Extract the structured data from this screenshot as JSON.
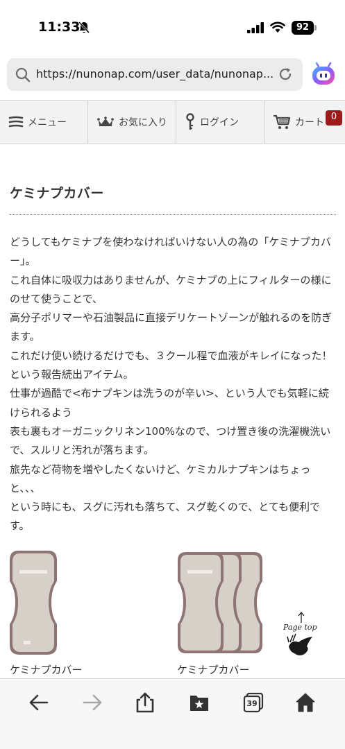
{
  "status_bar": {
    "time": "11:33",
    "battery": "92"
  },
  "browser": {
    "url": "https://nunonap.com/user_data/nunonap..."
  },
  "site_nav": {
    "items": [
      {
        "label": "メニュー",
        "icon": "hamburger-icon"
      },
      {
        "label": "お気に入り",
        "icon": "crown-icon"
      },
      {
        "label": "ログイン",
        "icon": "key-icon"
      },
      {
        "label": "カート",
        "icon": "cart-icon"
      }
    ],
    "cart_count": "0"
  },
  "content": {
    "title": "ケミナプカバー",
    "paragraphs": [
      "どうしてもケミナプを使わなければいけない人の為の「ケミナプカバー」。",
      "これ自体に吸収力はありませんが、ケミナプの上にフィルターの様にのせて使うことで、",
      "高分子ポリマーや石油製品に直接デリケートゾーンが触れるのを防ぎます。",
      "これだけ使い続けるだけでも、３クール程で血液がキレイになった！という報告続出アイテム。",
      "仕事が過酷で<布ナプキンは洗うのが辛い>、という人でも気軽に続けられるよう",
      "表も裏もオーガニックリネン100%なので、つけ置き後の洗濯機洗いで、スルリと汚れが落ちます。",
      "旅先など荷物を増やしたくないけど、ケミカルナプキンはちょっと、、、",
      "という時にも、スグに汚れも落ちて、スグ乾くので、とても便利です。"
    ],
    "products": [
      {
        "label": "ケミナプカバー"
      },
      {
        "label": "ケミナプカバー"
      }
    ],
    "page_top": "Page top"
  },
  "toolbar": {
    "tabs_count": "39",
    "buttons": [
      "back-icon",
      "forward-icon",
      "share-icon",
      "bookmarks-icon",
      "tabs-icon",
      "home-icon"
    ]
  },
  "colors": {
    "cart_badge": "#9b1b1b",
    "nav_bg": "#f3f3f3",
    "url_bar_bg": "#ececec"
  }
}
